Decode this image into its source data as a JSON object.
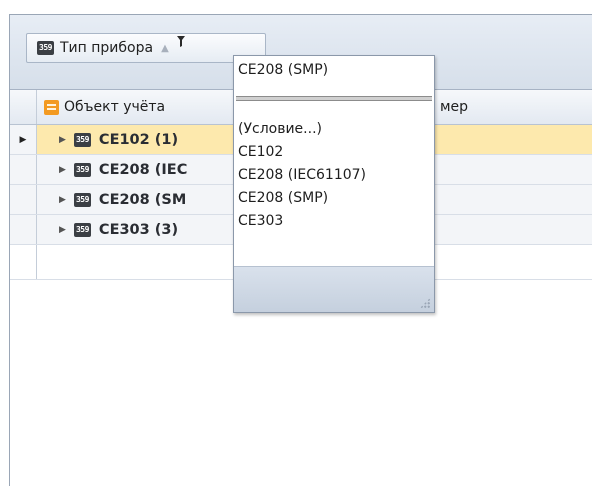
{
  "group_panel": {
    "chip_icon": "device-icon",
    "chip_icon_text": "359",
    "chip_label": "Тип прибора",
    "sort_indicator": "▲",
    "filter_icon": "filter-icon"
  },
  "columns": {
    "col1_icon": "table-icon",
    "col1_label": "Объект учёта",
    "col2_label": "мер"
  },
  "rows": [
    {
      "label": "CE102 (1)",
      "selected": true
    },
    {
      "label": "CE208 (IEC",
      "selected": false
    },
    {
      "label": "CE208 (SM",
      "selected": false
    },
    {
      "label": "CE303 (3)",
      "selected": false
    }
  ],
  "dropdown": {
    "current_value": "CE208 (SMP)",
    "items": [
      "(Условие...)",
      "CE102",
      "CE208 (IEC61107)",
      "CE208 (SMP)",
      "CE303"
    ]
  },
  "colors": {
    "selected_row": "#fde9ad",
    "panel_bg": "#dfe6ef",
    "border": "#9aa6b6"
  }
}
